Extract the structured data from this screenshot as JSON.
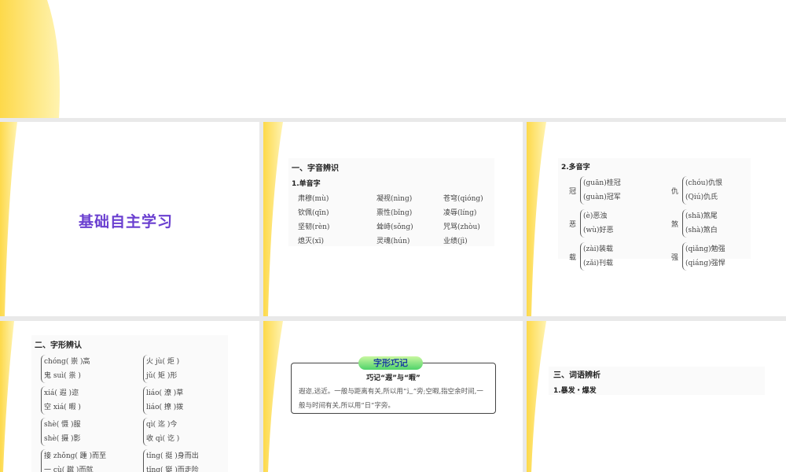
{
  "slides": {
    "title_slide": {
      "title": "基础自主学习"
    },
    "single": {
      "heading": "一、字音辨识",
      "sub": "1.单音字",
      "items": [
        "肃穆(mù)",
        "凝视(nìng)",
        "苍穹(qióng)",
        "钦佩(qīn)",
        "禀性(bǐng)",
        "凌辱(líng)",
        "坚韧(rèn)",
        "耸峙(sǒng)",
        "咒骂(zhòu)",
        "熄灭(xī)",
        "灵魂(hún)",
        "业绩(jì)"
      ]
    },
    "poly": {
      "sub": "2.多音字",
      "groups": [
        {
          "char": "冠",
          "a": "(guān)桂冠",
          "b": "(guàn)冠军"
        },
        {
          "char": "仇",
          "a": "(chóu)仇恨",
          "b": "(Qiú)仇氏"
        },
        {
          "char": "恶",
          "a": "(è)恶浊",
          "b": "(wù)好恶"
        },
        {
          "char": "煞",
          "a": "(shā)煞尾",
          "b": "(shà)煞白"
        },
        {
          "char": "载",
          "a": "(zài)装载",
          "b": "(zǎi)刊载"
        },
        {
          "char": "强",
          "a": "(qiǎng)勉强",
          "b": "(qiáng)强悍"
        }
      ]
    },
    "shape": {
      "heading": "二、字形辨认",
      "pairs": [
        {
          "a": "chóng( 崇 )高",
          "b": "鬼 suì( 祟 )"
        },
        {
          "a": "火 jù( 炬 )",
          "b": "jǔ( 矩 )形"
        },
        {
          "a": "xiá( 遐 )迩",
          "b": "空 xiá( 暇 )"
        },
        {
          "a": "liáo( 潦 )草",
          "b": "liáo( 撩 )拨"
        },
        {
          "a": "shè( 慑 )服",
          "b": "shè( 摄 )影"
        },
        {
          "a": "qì( 迄 )今",
          "b": "收 qì( 讫 )"
        },
        {
          "a": "接 zhǒng( 踵 )而至",
          "b": "一 cù( 蹴 )而就"
        },
        {
          "a": "tǐng( 挺 )身而出",
          "b": "tǐng( 铤 )而走险"
        }
      ]
    },
    "tip": {
      "badge": "字形巧记",
      "title": "巧记“遐”与“暇”",
      "body": "遐迩,远近。一般与距离有关,所以用“辶”旁;空暇,指空余时间,一般与时间有关,所以用“日”字旁。"
    },
    "words": {
      "heading": "三、词语辨析",
      "sub": "1.暴发・爆发"
    }
  },
  "colors": {
    "accent": "#6a3fd0",
    "yellow": "#fde36a"
  }
}
